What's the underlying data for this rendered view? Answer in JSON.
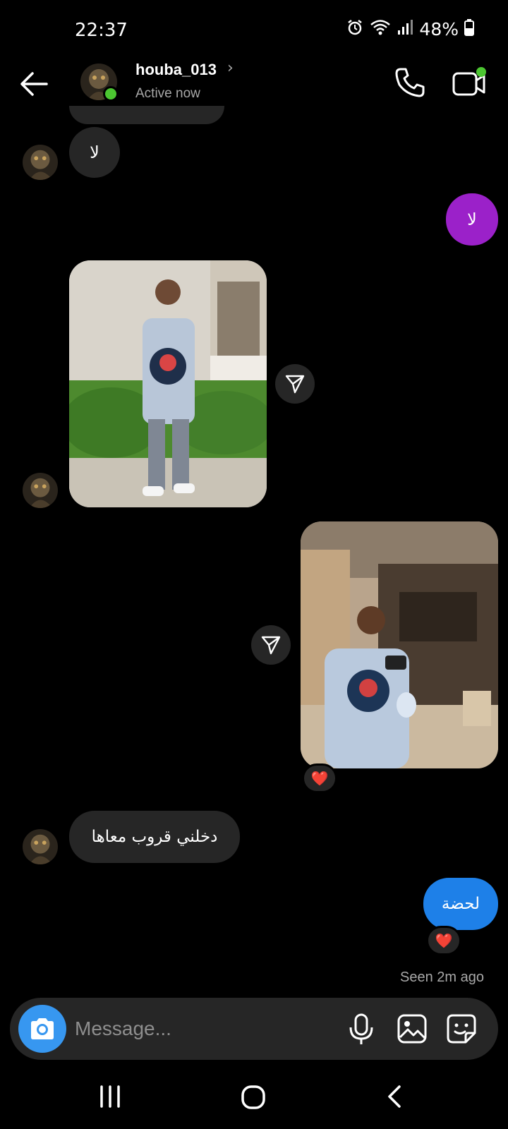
{
  "status_bar": {
    "time": "22:37",
    "battery": "48%",
    "icons": [
      "alarm-icon",
      "wifi-icon",
      "signal-icon",
      "battery-icon"
    ]
  },
  "header": {
    "username": "houba_013",
    "status": "Active now",
    "icons": [
      "back-arrow-icon",
      "chevron-right-icon",
      "phone-icon",
      "video-call-icon"
    ]
  },
  "messages": [
    {
      "from": "them",
      "type": "text",
      "text": "لا"
    },
    {
      "from": "me",
      "type": "text",
      "text": "لا"
    },
    {
      "from": "them",
      "type": "photo"
    },
    {
      "from": "me",
      "type": "photo",
      "reaction": "❤️"
    },
    {
      "from": "them",
      "type": "text",
      "text": "دخلني قروب معاها"
    },
    {
      "from": "me",
      "type": "text",
      "text": "لحضة",
      "reaction": "❤️"
    }
  ],
  "seen_text": "Seen 2m ago",
  "composer": {
    "placeholder": "Message...",
    "icons": [
      "camera-icon",
      "microphone-icon",
      "gallery-icon",
      "sticker-icon"
    ]
  },
  "colors": {
    "background": "#000000",
    "incoming_bubble": "#262626",
    "outgoing_purple": "#9b21c9",
    "outgoing_blue": "#1e80e8",
    "camera_button": "#3797f0",
    "online_dot": "#4cc631"
  },
  "navbar": {
    "icons": [
      "recent-apps-icon",
      "home-icon",
      "back-icon"
    ]
  }
}
